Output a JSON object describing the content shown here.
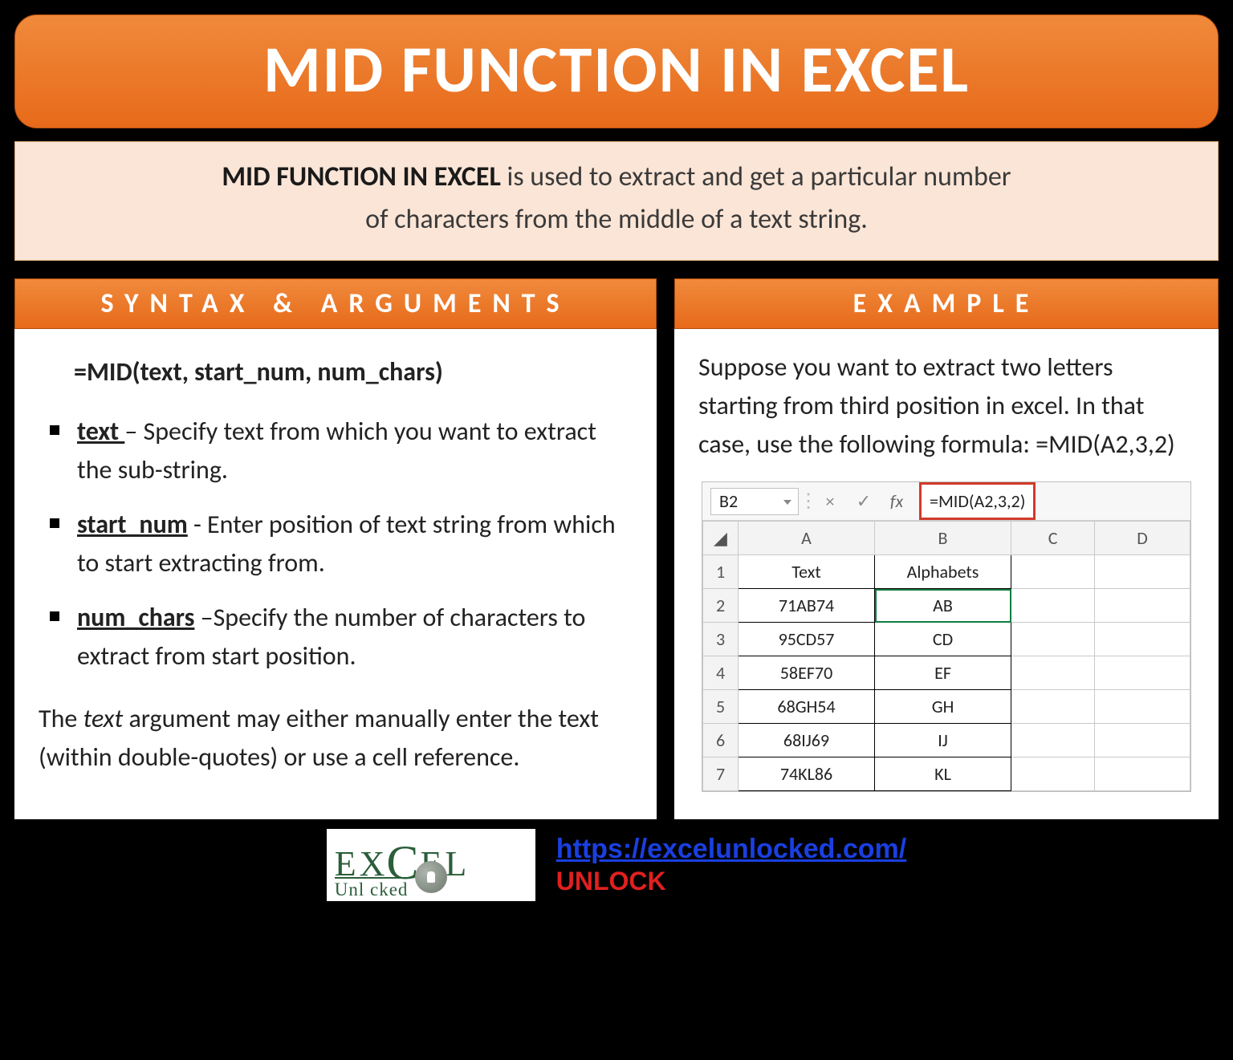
{
  "title": "MID FUNCTION IN EXCEL",
  "description": {
    "strong": "MID FUNCTION IN EXCEL",
    "rest1": " is used to extract and get a particular number",
    "rest2": "of characters from the middle of a text string."
  },
  "syntax": {
    "header": "SYNTAX & ARGUMENTS",
    "formula": "=MID(text, start_num, num_chars)",
    "args": [
      {
        "name": "text ",
        "desc": "– Specify text from which you want to extract the sub-string."
      },
      {
        "name": "start_num",
        "desc": " - Enter position of text string from which to start extracting from."
      },
      {
        "name": "num_chars",
        "desc": " –Specify the number of characters to extract from start position."
      }
    ],
    "note_pre": "The ",
    "note_italic": "text",
    "note_post": " argument may either manually enter the text (within double-quotes) or use a cell reference."
  },
  "example": {
    "header": "EXAMPLE",
    "text": "Suppose you want to extract two letters starting from third position in excel. In that case, use the following formula: =MID(A2,3,2)"
  },
  "excel": {
    "namebox": "B2",
    "fx_label": "fx",
    "formula": "=MID(A2,3,2)",
    "col_headers": [
      "A",
      "B",
      "C",
      "D"
    ],
    "row_headers": [
      "1",
      "2",
      "3",
      "4",
      "5",
      "6",
      "7"
    ],
    "header_row": [
      "Text",
      "Alphabets"
    ],
    "rows": [
      [
        "71AB74",
        "AB"
      ],
      [
        "95CD57",
        "CD"
      ],
      [
        "58EF70",
        "EF"
      ],
      [
        "68GH54",
        "GH"
      ],
      [
        "68IJ69",
        "IJ"
      ],
      [
        "74KL86",
        "KL"
      ]
    ]
  },
  "footer": {
    "logo_top1": "EX",
    "logo_top_c": "C",
    "logo_top2": "EL",
    "logo_bottom": "Unl   cked",
    "link": "https://excelunlocked.com/",
    "unlock": "UNLOCK"
  }
}
